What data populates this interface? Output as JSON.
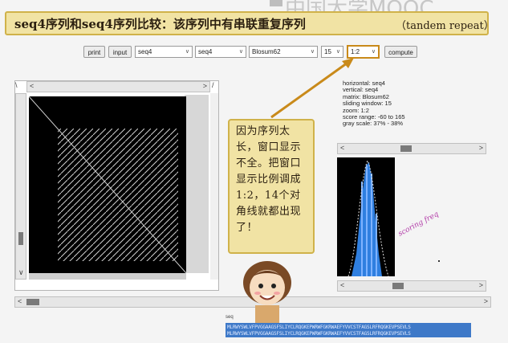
{
  "watermark": {
    "text": "中国大学MOOC"
  },
  "banner": {
    "title": "seq4序列和seq4序列比较：该序列中有串联重复序列",
    "subtitle": "（tandem repeat）"
  },
  "toolbar": {
    "print_label": "print",
    "input_label": "input",
    "horizontal_seq": "seq4",
    "vertical_seq": "seq4",
    "matrix": "Blosum62",
    "window": "15",
    "zoom": "1:2",
    "compute_label": "compute"
  },
  "callout": {
    "text": "因为序列太长，窗口显示不全。把窗口显示比例调成1:2，14个对角线就都出现了！"
  },
  "info": {
    "horizontal": "horizontal: seq4",
    "vertical": "vertical: seq4",
    "matrix": "matrix: Blosum62",
    "window": "sliding window: 15",
    "zoom": "zoom: 1:2",
    "score_range": "score range: -60 to 165",
    "gray_scale": "gray scale: 37% - 38%"
  },
  "histogram": {
    "annotation": "scoring freq"
  },
  "sequence": {
    "label": "seq",
    "line1": "MLRWYSWLVFPVGGAAGSFSLIYCLRQGKEPWRWFGKRWAEFYVVCSTFAGSLRFRQGKEVPSEVLS",
    "line2": "MLRWYSWLVFPVGGAAGSFSLIYCLRQGKEPWRWFGKRWAEFYVVCSTFAGSLRFRQGKEVPSEVLS"
  },
  "colors": {
    "banner_bg": "#f1e3a4",
    "banner_border": "#d0b24a",
    "highlight": "#c98a1a",
    "histogram_blue": "#2f7fe0"
  }
}
